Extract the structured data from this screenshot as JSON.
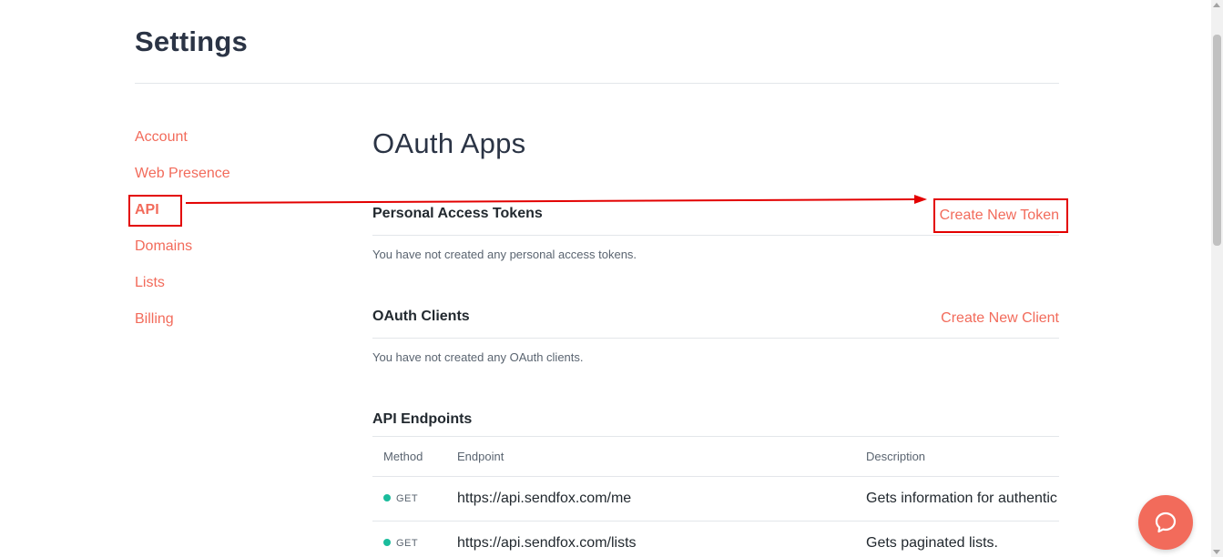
{
  "page": {
    "title": "Settings"
  },
  "sidebar": {
    "items": [
      {
        "label": "Account",
        "active": false
      },
      {
        "label": "Web Presence",
        "active": false
      },
      {
        "label": "API",
        "active": true
      },
      {
        "label": "Domains",
        "active": false
      },
      {
        "label": "Lists",
        "active": false
      },
      {
        "label": "Billing",
        "active": false
      }
    ]
  },
  "main": {
    "heading": "OAuth Apps",
    "personal_tokens": {
      "title": "Personal Access Tokens",
      "action_label": "Create New Token",
      "empty_text": "You have not created any personal access tokens."
    },
    "oauth_clients": {
      "title": "OAuth Clients",
      "action_label": "Create New Client",
      "empty_text": "You have not created any OAuth clients."
    },
    "endpoints": {
      "title": "API Endpoints",
      "columns": [
        "Method",
        "Endpoint",
        "Description"
      ],
      "rows": [
        {
          "method": "GET",
          "endpoint": "https://api.sendfox.com/me",
          "description": "Gets information for authentic"
        },
        {
          "method": "GET",
          "endpoint": "https://api.sendfox.com/lists",
          "description": "Gets paginated lists."
        }
      ]
    }
  },
  "colors": {
    "accent": "#f26b5b",
    "annotation": "#e30000",
    "method_get": "#1abc9c"
  },
  "icons": {
    "chat": "chat-bubble-icon"
  }
}
